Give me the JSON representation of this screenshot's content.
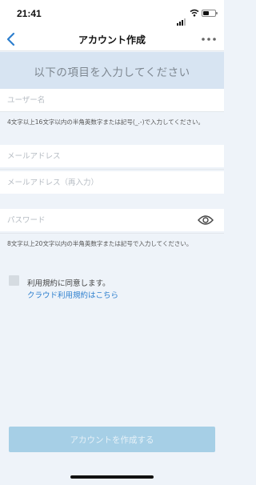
{
  "status_bar": {
    "time": "21:41"
  },
  "nav": {
    "title": "アカウント作成"
  },
  "heading": "以下の項目を入力してください",
  "fields": {
    "username": {
      "placeholder": "ユーザー名",
      "value": ""
    },
    "email": {
      "placeholder": "メールアドレス",
      "value": ""
    },
    "email_confirm": {
      "placeholder": "メールアドレス（再入力）",
      "value": ""
    },
    "password": {
      "placeholder": "パスワード",
      "value": ""
    }
  },
  "hints": {
    "username": "4文字以上16文字以内の半角英数字または記号(_.-)で入力してください。",
    "password": "8文字以上20文字以内の半角英数字または記号で入力してください。"
  },
  "terms": {
    "checked": false,
    "agree_label": "利用規約に同意します。",
    "link_label": "クラウド利用規約はこちら"
  },
  "submit_label": "アカウントを作成する",
  "colors": {
    "accent": "#2d7fce",
    "heading_band": "#d7e4f2",
    "submit_disabled": "#a6cfe6",
    "background": "#eef3f9"
  },
  "icons": [
    "signal-icon",
    "wifi-icon",
    "battery-icon",
    "back-chevron-icon",
    "more-icon",
    "eye-icon"
  ]
}
